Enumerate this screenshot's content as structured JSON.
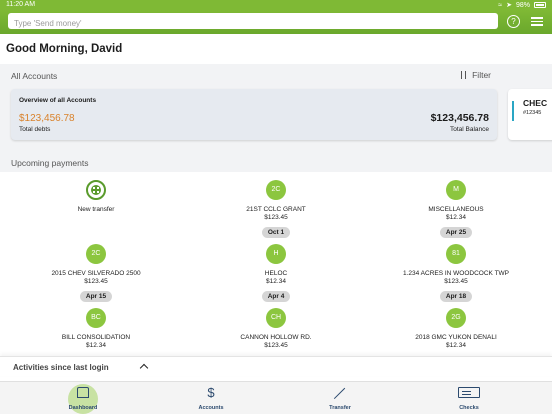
{
  "status_bar": {
    "time": "11:20 AM",
    "battery": "98%"
  },
  "search": {
    "placeholder": "Type 'Send money'"
  },
  "greeting": "Good Morning, David",
  "accounts": {
    "title": "All Accounts",
    "filter_label": "Filter",
    "overview": {
      "title": "Overview of all Accounts",
      "total_debts": "$123,456.78",
      "total_debts_label": "Total debts",
      "total_balance": "$123,456.78",
      "total_balance_label": "Total Balance"
    },
    "checking_card": {
      "title": "CHEC",
      "number": "#12345"
    }
  },
  "upcoming": {
    "title": "Upcoming payments",
    "items": [
      {
        "initials": "",
        "name": "New transfer",
        "amount": "",
        "date": ""
      },
      {
        "initials": "2C",
        "name": "21ST CCLC GRANT",
        "amount": "$123.45",
        "date": "Oct 1"
      },
      {
        "initials": "M",
        "name": "MISCELLANEOUS",
        "amount": "$12.34",
        "date": "Apr 25"
      },
      {
        "initials": "2C",
        "name": "2015 CHEV SILVERADO 2500",
        "amount": "$123.45",
        "date": "Apr 15"
      },
      {
        "initials": "H",
        "name": "HELOC",
        "amount": "$12.34",
        "date": "Apr 4"
      },
      {
        "initials": "81",
        "name": "1.234 ACRES IN WOODCOCK TWP",
        "amount": "$123.45",
        "date": "Apr 18"
      },
      {
        "initials": "BC",
        "name": "BILL CONSOLIDATION",
        "amount": "$12.34",
        "date": ""
      },
      {
        "initials": "CH",
        "name": "CANNON HOLLOW RD.",
        "amount": "$123.45",
        "date": ""
      },
      {
        "initials": "2G",
        "name": "2018 GMC YUKON DENALI",
        "amount": "$12.34",
        "date": ""
      }
    ]
  },
  "activities": {
    "title": "Activities since last login"
  },
  "tabs": [
    {
      "label": "Dashboard",
      "icon": "home-icon"
    },
    {
      "label": "Accounts",
      "icon": "dollar-icon"
    },
    {
      "label": "Transfer",
      "icon": "transfer-icon"
    },
    {
      "label": "Checks",
      "icon": "check-icon"
    }
  ],
  "colors": {
    "brand_green": "#7fb935",
    "debt_orange": "#d9822b",
    "accent_teal": "#2aa6c4"
  }
}
